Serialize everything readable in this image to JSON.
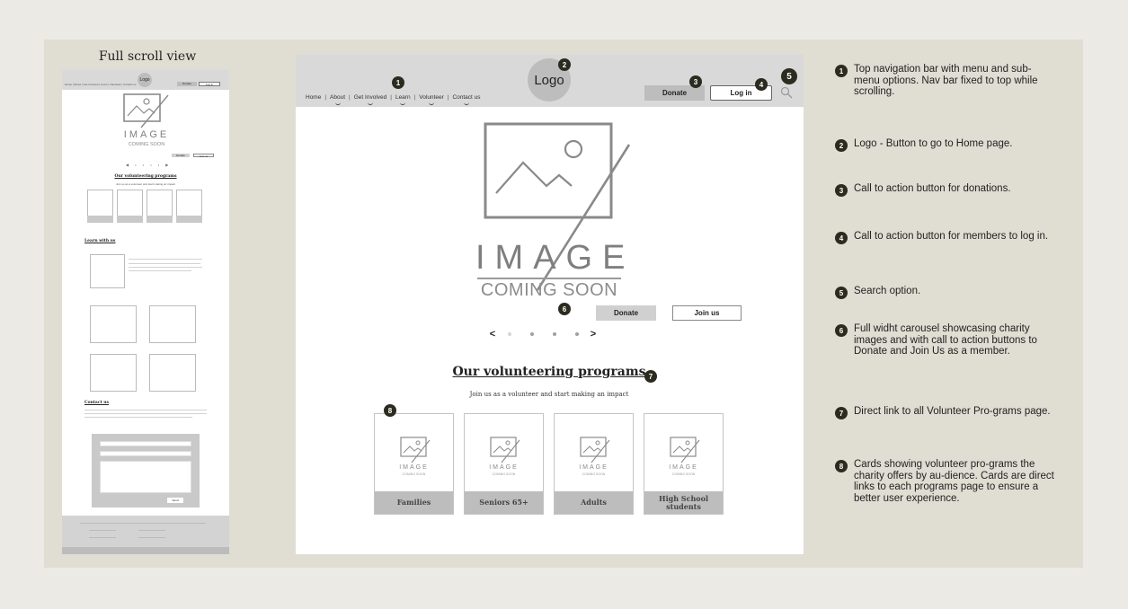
{
  "scroll_view": {
    "title": "Full scroll view",
    "logo": "Logo",
    "nav_links": "Home | About | Get Involved | Learn | Volunteer | Contact us",
    "donate": "Donate",
    "login": "Log in",
    "image_word": "IMAGE",
    "image_sub": "COMING SOON",
    "hero_donate": "Donate",
    "hero_join": "Join us",
    "programs_title": "Our volunteering programs",
    "programs_sub": "Join us as a volunteer and start making an impact",
    "cards": [
      "Families",
      "Seniors 65+",
      "Adults",
      "High school students"
    ],
    "learn_title": "Learn with us",
    "contact_title": "Contact us",
    "send": "Send"
  },
  "nav": {
    "links": [
      {
        "label": "Home",
        "sub": false
      },
      {
        "label": "About",
        "sub": true
      },
      {
        "label": "Get Involved",
        "sub": true
      },
      {
        "label": "Learn",
        "sub": true
      },
      {
        "label": "Volunteer",
        "sub": true
      },
      {
        "label": "Contact us",
        "sub": true
      }
    ],
    "logo": "Logo",
    "donate": "Donate",
    "login": "Log in",
    "search_icon": "search-icon"
  },
  "hero": {
    "image_word": "IMAGE",
    "image_sub": "COMING SOON",
    "donate": "Donate",
    "join": "Join us",
    "prev": "<",
    "next": ">",
    "dots": 5
  },
  "programs": {
    "title": "Our volunteering programs",
    "subtitle": "Join us as a volunteer and start making an impact",
    "cards": [
      {
        "label": "Families",
        "img": "IMAGE",
        "soon": "COMING SOON"
      },
      {
        "label": "Seniors 65+",
        "img": "IMAGE",
        "soon": "COMING SOON"
      },
      {
        "label": "Adults",
        "img": "IMAGE",
        "soon": "COMING SOON"
      },
      {
        "label": "High School students",
        "img": "IMAGE",
        "soon": "COMING SOON"
      }
    ]
  },
  "badges": [
    "1",
    "2",
    "3",
    "4",
    "5",
    "6",
    "7",
    "8"
  ],
  "notes": [
    {
      "num": "1",
      "text": "Top navigation bar with menu and sub-menu options. Nav bar fixed to top while scrolling."
    },
    {
      "num": "2",
      "text": "Logo - Button to go to Home page."
    },
    {
      "num": "3",
      "text": "Call to action button for donations."
    },
    {
      "num": "4",
      "text": "Call to action button for members to log in."
    },
    {
      "num": "5",
      "text": "Search option."
    },
    {
      "num": "6",
      "text": "Full widht carousel showcasing charity images and with call to action buttons to Donate and Join Us as a member."
    },
    {
      "num": "7",
      "text": "Direct link to all Volunteer Pro-grams page."
    },
    {
      "num": "8",
      "text": "Cards showing volunteer pro-grams the charity offers by au-dience. Cards are direct links to each programs page to ensure a better user experience."
    }
  ],
  "colors": {
    "page_bg": "#eceae4",
    "panel_bg": "#e0ddd3",
    "nav_bg": "#d9d9d9",
    "badge": "#2b2b20",
    "button_gray": "#bdbdbd"
  }
}
